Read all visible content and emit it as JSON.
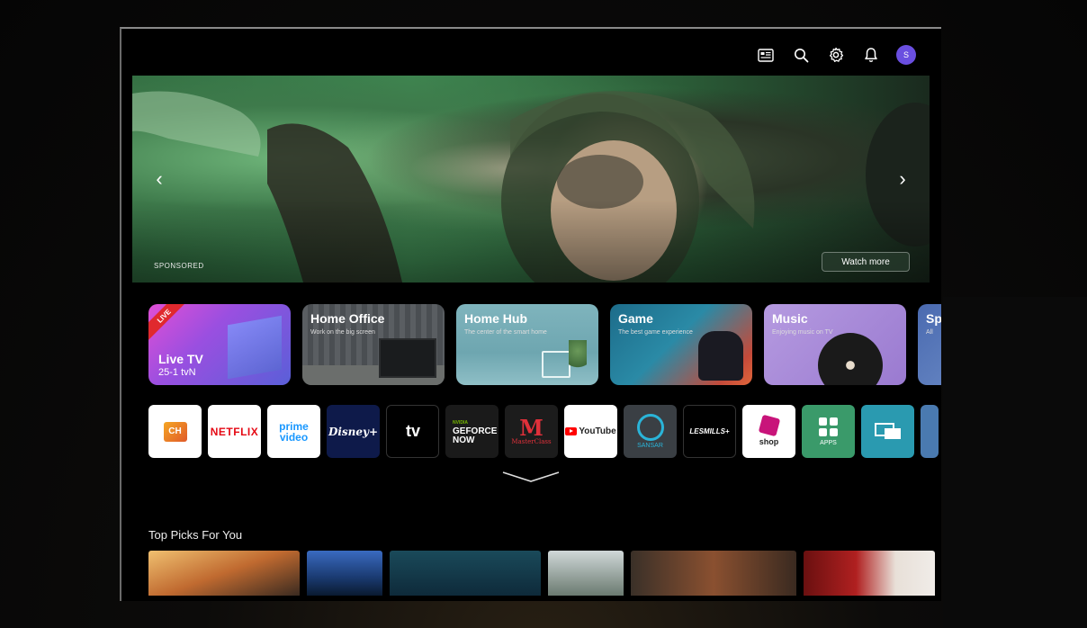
{
  "topbar": {
    "icons": [
      "guide-icon",
      "search-icon",
      "settings-icon",
      "bell-icon"
    ],
    "avatar_initial": "S"
  },
  "hero": {
    "sponsored_label": "SPONSORED",
    "watch_more_label": "Watch more",
    "prev_glyph": "‹",
    "next_glyph": "›"
  },
  "cards": [
    {
      "id": "live-tv",
      "badge": "LIVE",
      "title": "Live TV",
      "channel": "25-1  tvN"
    },
    {
      "id": "home-office",
      "title": "Home Office",
      "subtitle": "Work on the big screen"
    },
    {
      "id": "home-hub",
      "title": "Home Hub",
      "subtitle": "The center of the smart home"
    },
    {
      "id": "game",
      "title": "Game",
      "subtitle": "The best game experience"
    },
    {
      "id": "music",
      "title": "Music",
      "subtitle": "Enjoying music on TV"
    },
    {
      "id": "sports",
      "title": "Sp",
      "subtitle": "All"
    }
  ],
  "apps": [
    {
      "id": "channels",
      "label": "CH"
    },
    {
      "id": "netflix",
      "label": "NETFLIX"
    },
    {
      "id": "prime-video",
      "label_top": "prime",
      "label_bottom": "video"
    },
    {
      "id": "disney-plus",
      "label": "Disney+"
    },
    {
      "id": "apple-tv",
      "label": "tv"
    },
    {
      "id": "geforce-now",
      "label_top": "NVIDIA",
      "label_mid": "GEFORCE",
      "label_bottom": "NOW"
    },
    {
      "id": "masterclass",
      "label": "MasterClass"
    },
    {
      "id": "youtube",
      "label": "YouTube"
    },
    {
      "id": "sansar",
      "label": "SANSAR"
    },
    {
      "id": "lesmills",
      "label": "LESMILLS+"
    },
    {
      "id": "shoptime",
      "label": "shop"
    },
    {
      "id": "apps",
      "label": "APPS"
    },
    {
      "id": "screen-share",
      "label": ""
    },
    {
      "id": "partial",
      "label": ""
    }
  ],
  "section": {
    "title": "Top Picks For You"
  },
  "colors": {
    "netflix": "#e50914",
    "disney": "#0e1a4a",
    "youtube": "#ff0000",
    "apps_tile": "#3a9a6a",
    "avatar": "#6a4fe0",
    "live_badge": "#e0292e"
  }
}
